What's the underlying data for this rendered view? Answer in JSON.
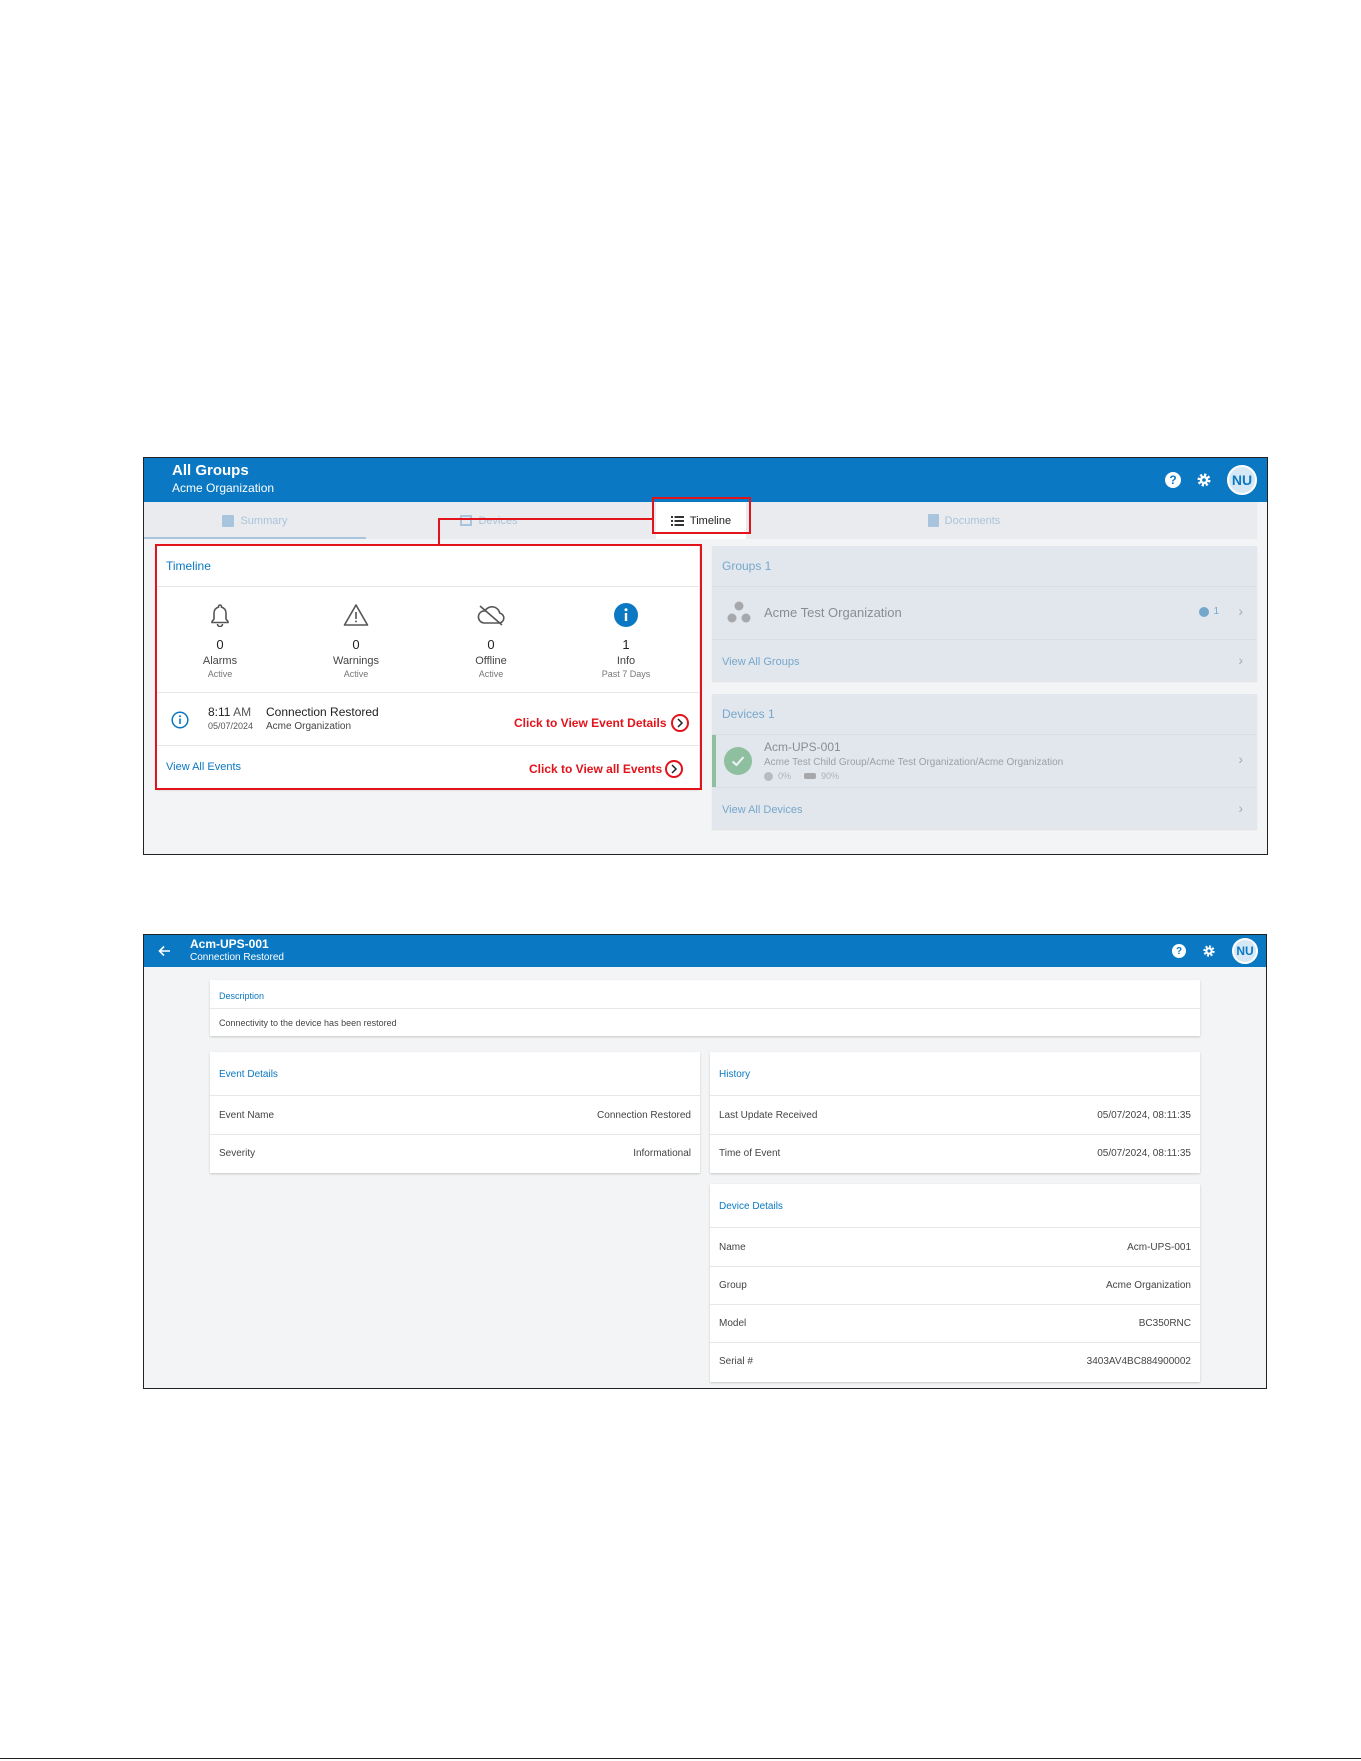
{
  "colors": {
    "brand": "#0a78c2",
    "annotation": "#e2131b",
    "success": "#3aa755"
  },
  "shot1": {
    "header": {
      "title": "All Groups",
      "subtitle": "Acme Organization",
      "avatar": "NU",
      "help_icon": "?"
    },
    "tabs": {
      "summary": "Summary",
      "devices": "Devices",
      "timeline": "Timeline",
      "documents": "Documents"
    },
    "timeline_card": {
      "title": "Timeline",
      "stats": [
        {
          "count": "0",
          "label": "Alarms",
          "sub": "Active",
          "icon": "bell-icon"
        },
        {
          "count": "0",
          "label": "Warnings",
          "sub": "Active",
          "icon": "warning-icon"
        },
        {
          "count": "0",
          "label": "Offline",
          "sub": "Active",
          "icon": "cloud-off-icon"
        },
        {
          "count": "1",
          "label": "Info",
          "sub": "Past 7 Days",
          "icon": "info-icon"
        }
      ],
      "event": {
        "time": "8:11",
        "ampm": "AM",
        "date": "05/07/2024",
        "name": "Connection Restored",
        "org": "Acme Organization"
      },
      "view_all": "View All Events"
    },
    "annotations": {
      "event_details": "Click to View Event Details",
      "all_events": "Click to View all Events"
    },
    "groups_card": {
      "title": "Groups 1",
      "item": "Acme Test Organization",
      "badge": "1",
      "view_all": "View All Groups"
    },
    "devices_card": {
      "title": "Devices 1",
      "device": {
        "name": "Acm-UPS-001",
        "path": "Acme Test Child Group/Acme Test Organization/Acme Organization",
        "load": "0%",
        "battery": "90%"
      },
      "view_all": "View All Devices"
    }
  },
  "shot2": {
    "header": {
      "title": "Acm-UPS-001",
      "subtitle": "Connection Restored",
      "avatar": "NU",
      "help_icon": "?"
    },
    "description": {
      "title": "Description",
      "text": "Connectivity to the device has been restored"
    },
    "event_details": {
      "title": "Event Details",
      "rows": [
        {
          "key": "Event Name",
          "value": "Connection Restored"
        },
        {
          "key": "Severity",
          "value": "Informational"
        }
      ]
    },
    "history": {
      "title": "History",
      "rows": [
        {
          "key": "Last Update Received",
          "value": "05/07/2024, 08:11:35"
        },
        {
          "key": "Time of Event",
          "value": "05/07/2024, 08:11:35"
        }
      ]
    },
    "device_details": {
      "title": "Device Details",
      "rows": [
        {
          "key": "Name",
          "value": "Acm-UPS-001"
        },
        {
          "key": "Group",
          "value": "Acme Organization"
        },
        {
          "key": "Model",
          "value": "BC350RNC"
        },
        {
          "key": "Serial #",
          "value": "3403AV4BC884900002"
        }
      ]
    }
  }
}
